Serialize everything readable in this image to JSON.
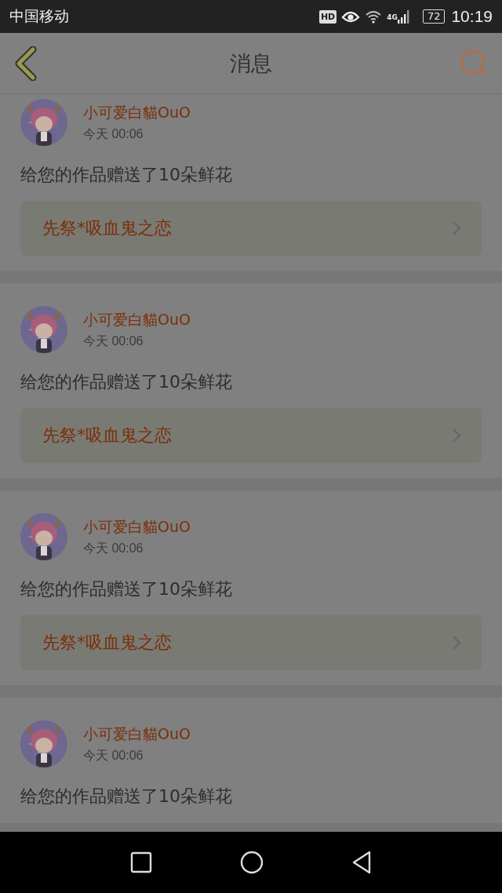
{
  "status_bar": {
    "carrier": "中国移动",
    "hd": "HD",
    "network": "4G",
    "battery": "72",
    "time": "10:19"
  },
  "header": {
    "title": "消息"
  },
  "messages": [
    {
      "kind": "gift",
      "user": "小可爱白貓OuO",
      "time": "今天 00:06",
      "text": "给您的作品赠送了10朵鲜花",
      "link": "先祭*吸血鬼之恋"
    },
    {
      "kind": "gift",
      "user": "小可爱白貓OuO",
      "time": "今天 00:06",
      "text": "给您的作品赠送了10朵鲜花",
      "link": "先祭*吸血鬼之恋"
    },
    {
      "kind": "gift",
      "user": "小可爱白貓OuO",
      "time": "今天 00:06",
      "text": "给您的作品赠送了10朵鲜花",
      "link": "先祭*吸血鬼之恋"
    },
    {
      "kind": "gift",
      "user": "小可爱白貓OuO",
      "time": "今天 00:06",
      "text": "给您的作品赠送了10朵鲜花"
    }
  ]
}
